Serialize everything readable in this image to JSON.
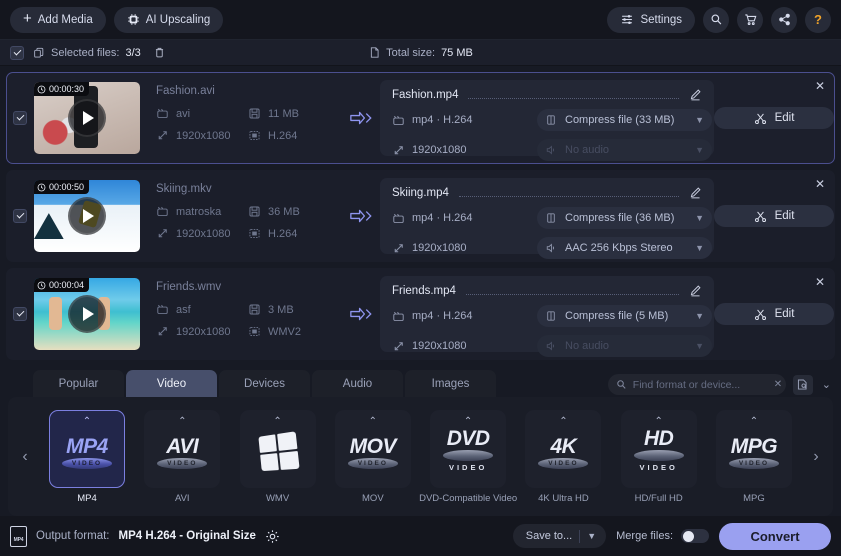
{
  "topbar": {
    "add_media": "Add Media",
    "ai_upscaling": "AI Upscaling",
    "settings": "Settings",
    "icons": [
      "search-icon",
      "cart-icon",
      "share-icon",
      "help-icon"
    ],
    "help_glyph": "?"
  },
  "selection_bar": {
    "selected_files_label": "Selected files:",
    "selected_files_value": "3/3",
    "total_size_label": "Total size:",
    "total_size_value": "75 MB",
    "trash_icon": "trash-icon"
  },
  "files": [
    {
      "duration": "00:00:30",
      "source_name": "Fashion.avi",
      "source_container": "avi",
      "source_size": "11 MB",
      "source_resolution": "1920x1080",
      "source_codec": "H.264",
      "target_name": "Fashion.mp4",
      "target_codec": "mp4 · H.264",
      "target_resolution": "1920x1080",
      "compress": "Compress file (33 MB)",
      "audio": "No audio",
      "audio_disabled": true,
      "edit_label": "Edit",
      "selected": true
    },
    {
      "duration": "00:00:50",
      "source_name": "Skiing.mkv",
      "source_container": "matroska",
      "source_size": "36 MB",
      "source_resolution": "1920x1080",
      "source_codec": "H.264",
      "target_name": "Skiing.mp4",
      "target_codec": "mp4 · H.264",
      "target_resolution": "1920x1080",
      "compress": "Compress file (36 MB)",
      "audio": "AAC 256 Kbps Stereo",
      "audio_disabled": false,
      "edit_label": "Edit",
      "selected": false
    },
    {
      "duration": "00:00:04",
      "source_name": "Friends.wmv",
      "source_container": "asf",
      "source_size": "3 MB",
      "source_resolution": "1920x1080",
      "source_codec": "WMV2",
      "target_name": "Friends.mp4",
      "target_codec": "mp4 · H.264",
      "target_resolution": "1920x1080",
      "compress": "Compress file (5 MB)",
      "audio": "No audio",
      "audio_disabled": true,
      "edit_label": "Edit",
      "selected": false
    }
  ],
  "tabs": [
    {
      "label": "Popular",
      "selected": false
    },
    {
      "label": "Video",
      "selected": true
    },
    {
      "label": "Devices",
      "selected": false
    },
    {
      "label": "Audio",
      "selected": false
    },
    {
      "label": "Images",
      "selected": false
    }
  ],
  "search": {
    "placeholder": "Find format or device...",
    "value": "",
    "clear_icon": "close-icon",
    "preset_icon": "saved-presets-icon",
    "collapse_icon": "chevron-down-icon"
  },
  "format_cards": [
    {
      "logo": "MP4",
      "badge": "VIDEO",
      "label": "MP4",
      "style": "ellipse",
      "selected": true
    },
    {
      "logo": "AVI",
      "badge": "VIDEO",
      "label": "AVI",
      "style": "ellipse",
      "selected": false
    },
    {
      "logo": "",
      "badge": "",
      "label": "WMV",
      "style": "windows",
      "selected": false
    },
    {
      "logo": "MOV",
      "badge": "VIDEO",
      "label": "MOV",
      "style": "ellipse",
      "selected": false
    },
    {
      "logo": "DVD",
      "badge": "",
      "sub": "VIDEO",
      "label": "DVD-Compatible Video",
      "style": "ellipse-sub",
      "selected": false
    },
    {
      "logo": "4K",
      "badge": "VIDEO",
      "label": "4K Ultra HD",
      "style": "ellipse",
      "selected": false
    },
    {
      "logo": "HD",
      "badge": "",
      "sub": "VIDEO",
      "label": "HD/Full HD",
      "style": "ellipse-sub",
      "selected": false
    },
    {
      "logo": "MPG",
      "badge": "VIDEO",
      "label": "MPG",
      "style": "ellipse",
      "selected": false
    }
  ],
  "carousel": {
    "prev": "‹",
    "next": "›"
  },
  "bottom": {
    "output_format_label": "Output format:",
    "output_format_value": "MP4 H.264 - Original Size",
    "gear_icon": "gear-icon",
    "save_to": "Save to...",
    "merge_files": "Merge files:",
    "merge_on": false,
    "convert": "Convert"
  },
  "colors": {
    "accent": "#9aa0f0",
    "selected_tab": "#474f6b",
    "panel_bg": "#1a1d27",
    "row_bg": "#1b1e2a",
    "help": "#f0a32a"
  }
}
